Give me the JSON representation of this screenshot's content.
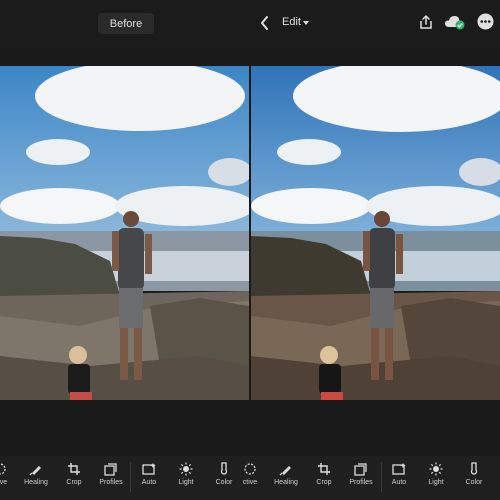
{
  "topbar": {
    "before_label": "Before",
    "edit_label": "Edit"
  },
  "toolbar": {
    "tools": [
      {
        "label": "ctive"
      },
      {
        "label": "Healing"
      },
      {
        "label": "Crop"
      },
      {
        "label": "Profiles"
      },
      {
        "label": "Auto"
      },
      {
        "label": "Light"
      },
      {
        "label": "Color"
      },
      {
        "label": "ctive"
      },
      {
        "label": "Healing"
      },
      {
        "label": "Crop"
      },
      {
        "label": "Profiles"
      },
      {
        "label": "Auto"
      },
      {
        "label": "Light"
      },
      {
        "label": "Color"
      }
    ]
  },
  "icons": [
    "chevron-left-icon",
    "caret-down-icon",
    "share-icon",
    "cloud-sync-icon",
    "more-icon",
    "selective-icon",
    "healing-brush-icon",
    "crop-icon",
    "profiles-icon",
    "auto-icon",
    "light-icon",
    "color-icon"
  ],
  "colors": {
    "background": "#1a1a1a",
    "toolbar": "#1f1f1f",
    "sync_badge": "#2fb36b"
  }
}
